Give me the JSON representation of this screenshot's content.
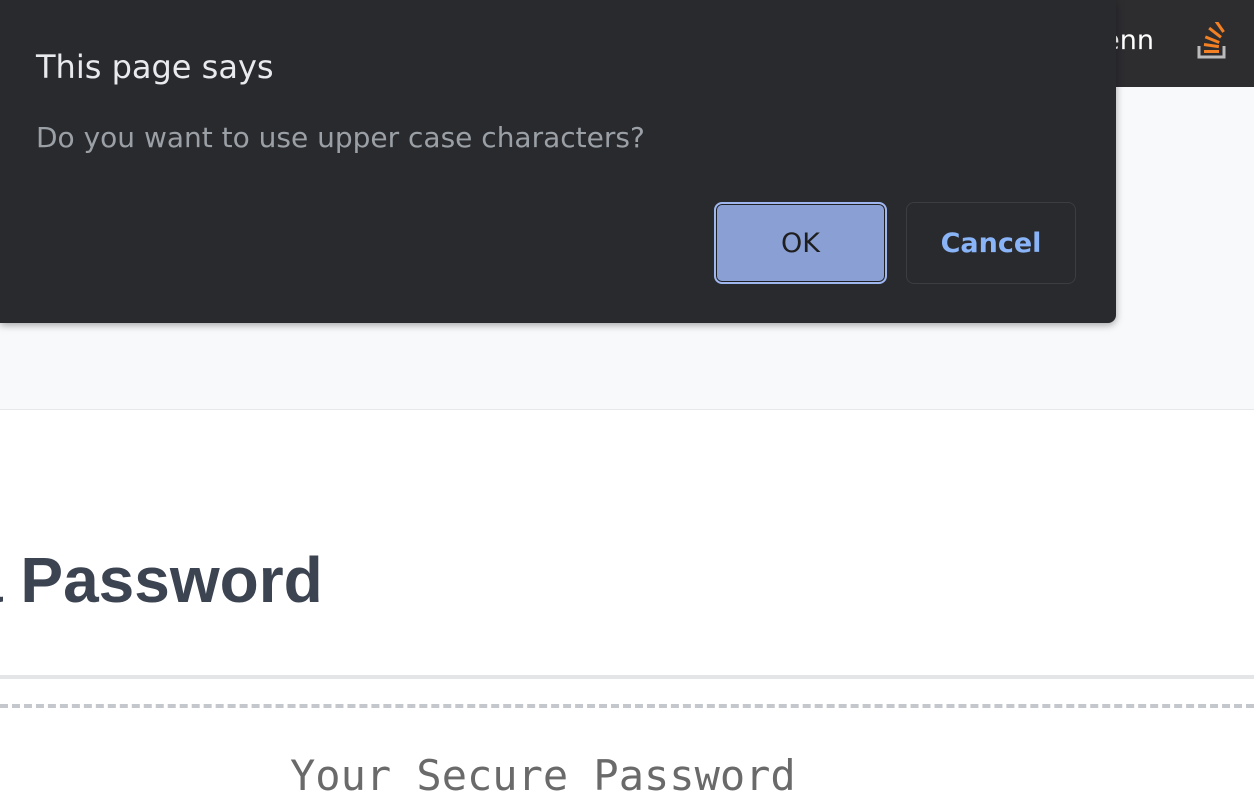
{
  "topbar": {
    "user_name": "enn",
    "icon": "stack-overflow-icon",
    "icon_color": "#f48024"
  },
  "page": {
    "title": "a Password",
    "password_placeholder": "Your Secure Password"
  },
  "dialog": {
    "title": "This page says",
    "message": "Do you want to use upper case characters?",
    "ok_label": "OK",
    "cancel_label": "Cancel"
  },
  "colors": {
    "dialog_background": "#292a2d",
    "ok_button": "#8a9fd4",
    "cancel_text": "#8ab4f8",
    "page_title": "#3c4451"
  }
}
